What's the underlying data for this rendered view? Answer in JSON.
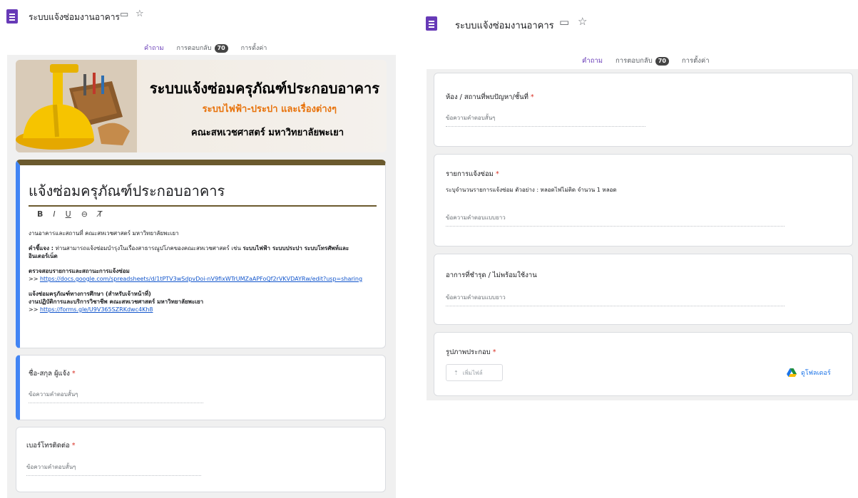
{
  "app": {
    "doc_title": "ระบบแจ้งซ่อมงานอาคาร",
    "tabs": [
      {
        "label": "คำถาม",
        "active": true
      },
      {
        "label": "การตอบกลับ",
        "count": "70"
      },
      {
        "label": "การตั้งค่า"
      }
    ],
    "accent_color": "#673ab7",
    "folder_icon": "folder-icon",
    "star_icon": "star-icon"
  },
  "banner": {
    "title": "ระบบแจ้งซ่อมครุภัณฑ์ประกอบอาคาร",
    "subtitle": "ระบบไฟฟ้า-ประปา และเรื่องต่างๆ",
    "faculty": "คณะสหเวชศาสตร์ มหาวิทยาลัยพะเยา"
  },
  "form_header": {
    "title": "แจ้งซ่อมครุภัณฑ์ประกอบอาคาร",
    "format_buttons": [
      "B",
      "I",
      "U",
      "⊖",
      "T̸"
    ],
    "description": {
      "line1": "งานอาคารและสถานที่ คณะสหเวชศาสตร์ มหาวิทยาลัยพะเยา",
      "note_label": "คำชี้แจง :",
      "note_text": "ท่านสามารถแจ้งซ่อมบำรุงในเรื่องสาธารณูปโภคของคณะสหเวชศาสตร์ เช่น",
      "note_bold": "ระบบไฟฟ้า ระบบประปา ระบบโทรศัพท์และอินเตอร์เน็ต",
      "check_label": "ตรวจสอบรายการและสถานะการแจ้งซ่อม",
      "arrows1": ">> ",
      "check_link": "https://docs.google.com/spreadsheets/d/1tPTV3wSdpvDoi-nV9fixWTrUMZaAPFoQf2rVKVDAYRw/edit?usp=sharing",
      "edu_label": "แจ้งซ่อมครุภัณฑ์ทางการศึกษา (สำหรับเจ้าหน้าที่)",
      "edu_unit": "งานปฏิบัติการและบริการวิชาชีพ คณะสหเวชศาสตร์ มหาวิทยาลัยพะเยา",
      "arrows2": ">> ",
      "edu_link": "https://forms.gle/U9V365SZRKdwc4Kh8"
    }
  },
  "questions_left": [
    {
      "title": "ชื่อ-สกุล ผู้แจ้ง",
      "required": "*",
      "placeholder": "ข้อความคำตอบสั้นๆ"
    },
    {
      "title": "เบอร์โทรติดต่อ",
      "required": "*",
      "placeholder": "ข้อความคำตอบสั้นๆ"
    }
  ],
  "questions_right": [
    {
      "title": "ห้อง / สถานที่พบปัญหา/ชั้นที่",
      "required": "*",
      "placeholder": "ข้อความคำตอบสั้นๆ"
    },
    {
      "title": "รายการแจ้งซ่อม",
      "required": "*",
      "help": "ระบุจำนวนรายการแจ้งซ่อม ตัวอย่าง : หลอดไฟไม่ติด จำนวน 1 หลอด",
      "placeholder": "ข้อความคำตอบแบบยาว"
    },
    {
      "title": "อาการที่ชำรุด / ไม่พร้อมใช้งาน",
      "placeholder": "ข้อความคำตอบแบบยาว"
    },
    {
      "title": "รูปภาพประกอบ",
      "required": "*",
      "upload_label": "เพิ่มไฟล์",
      "drive_label": "ดูโฟลเดอร์"
    }
  ]
}
